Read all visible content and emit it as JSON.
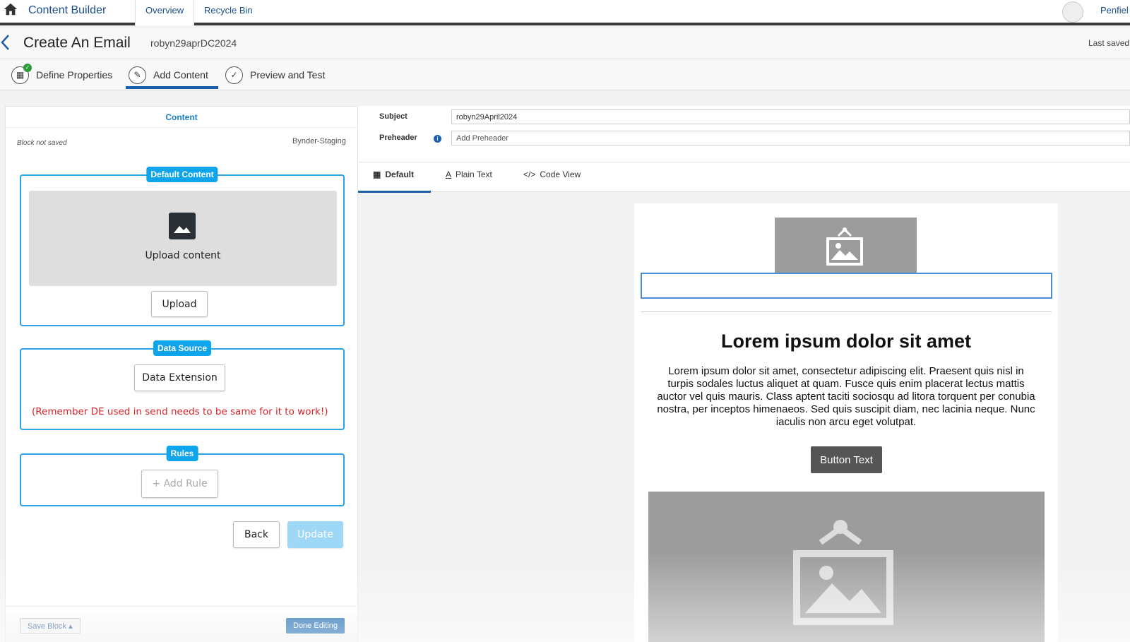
{
  "topnav": {
    "app_title": "Content Builder",
    "tabs": [
      {
        "label": "Overview"
      },
      {
        "label": "Recycle Bin"
      }
    ],
    "user": "Penfiel"
  },
  "titlebar": {
    "title": "Create An Email",
    "email_name": "robyn29aprDC2024",
    "last_saved": "Last saved"
  },
  "steps": [
    {
      "label": "Define Properties"
    },
    {
      "label": "Add Content"
    },
    {
      "label": "Preview and Test"
    }
  ],
  "content_panel": {
    "title": "Content",
    "block_status": "Block not saved",
    "source": "Bynder-Staging",
    "default_content": {
      "label": "Default Content",
      "upload_text": "Upload content",
      "upload_button": "Upload"
    },
    "data_source": {
      "label": "Data Source",
      "button": "Data Extension",
      "note": "(Remember DE used in send needs to be same for it to work!)"
    },
    "rules": {
      "label": "Rules",
      "add_rule": "+ Add Rule"
    },
    "back_button": "Back",
    "update_button": "Update",
    "save_block": "Save Block ▴",
    "done_editing": "Done Editing"
  },
  "meta": {
    "subject_label": "Subject",
    "subject_value": "robyn29April2024",
    "preheader_label": "Preheader",
    "preheader_placeholder": "Add Preheader"
  },
  "view_tabs": [
    {
      "label": "Default"
    },
    {
      "label": "Plain Text"
    },
    {
      "label": "Code View"
    }
  ],
  "email": {
    "heading": "Lorem ipsum dolor sit amet",
    "paragraph": "Lorem ipsum dolor sit amet, consectetur adipiscing elit. Praesent quis nisl in turpis sodales luctus aliquet at quam. Fusce quis enim placerat lectus mattis auctor vel quis mauris. Class aptent taciti sociosqu ad litora torquent per conubia nostra, per inceptos himenaeos. Sed quis suscipit diam, nec lacinia neque. Nunc iaculis non arcu eget volutpat.",
    "button_text": "Button Text"
  },
  "colors": {
    "accent": "#1b5fa8",
    "box_border": "#29a3e6",
    "warning_text": "#d8232a"
  }
}
